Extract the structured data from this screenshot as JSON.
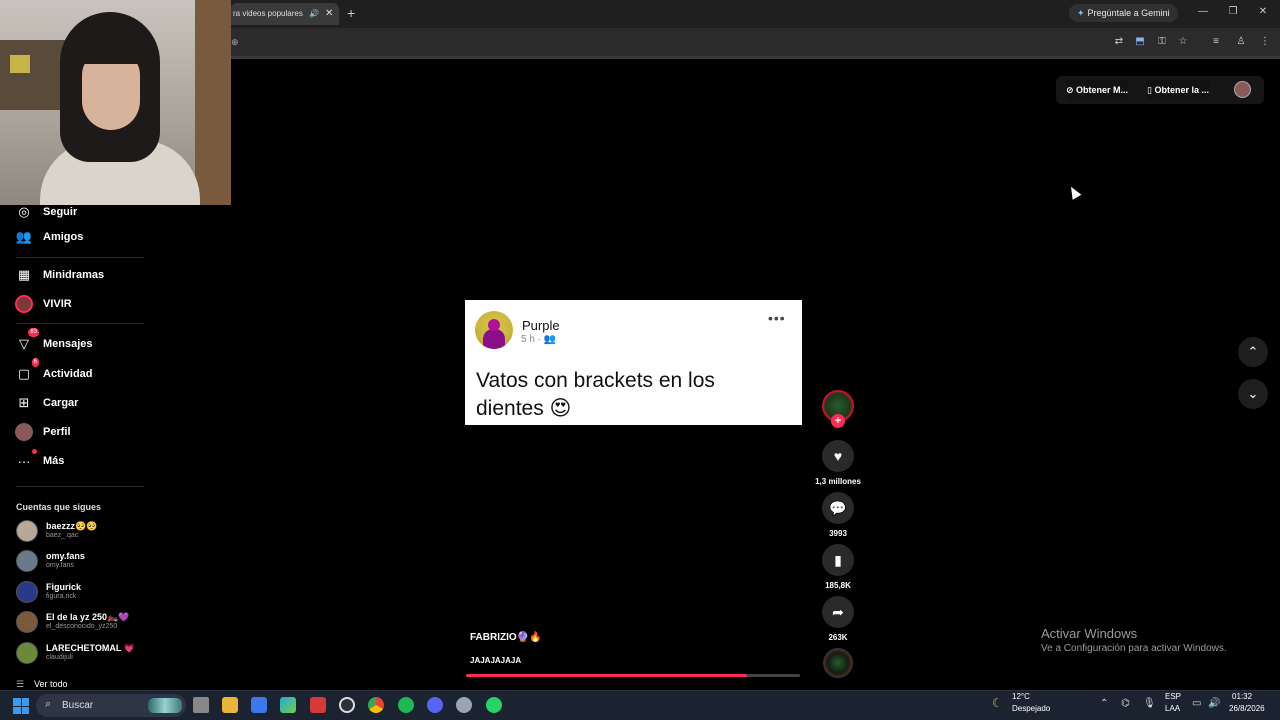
{
  "browser": {
    "tab_title": "ra videos populares",
    "tab_speaker": "🔊",
    "tab_close": "✕",
    "new_tab": "+",
    "gemini_label": "Pregúntale a Gemini",
    "win_minimize": "—",
    "win_restore": "❐",
    "win_close": "✕",
    "addr_fragment": "⊕"
  },
  "sidebar": {
    "items": [
      {
        "label": "Seguir"
      },
      {
        "label": "Amigos"
      },
      {
        "label": "Minidramas"
      },
      {
        "label": "VIVIR"
      },
      {
        "label": "Mensajes",
        "badge": "83"
      },
      {
        "label": "Actividad",
        "badge": "6"
      },
      {
        "label": "Cargar"
      },
      {
        "label": "Perfil"
      },
      {
        "label": "Más"
      }
    ],
    "following_title": "Cuentas que sigues",
    "accounts": [
      {
        "name": "baezzz🥺🥺",
        "handle": "baez_.qac"
      },
      {
        "name": "omy.fans",
        "handle": "omy.fans"
      },
      {
        "name": "Figurick",
        "handle": "figura.rick"
      },
      {
        "name": "El de la yz 250🏍️💜",
        "handle": "el_desconocido_yz250"
      },
      {
        "name": "LARECHETOMAL 💗",
        "handle": "claudijuli"
      }
    ],
    "see_all": "Ver todo"
  },
  "top_actions": {
    "get_m": "Obtener M...",
    "get_app": "Obtener la ..."
  },
  "post": {
    "author": "Purple",
    "meta": "5 h · 👥",
    "more": "•••",
    "text": "Vatos con brackets en los dientes 😍"
  },
  "video": {
    "user": "FABRIZIO🔮🔥",
    "caption": "JAJAJAJAJA",
    "progress": 0.84
  },
  "rail": {
    "follow_plus": "+",
    "likes": "1,3 millones",
    "comments": "3993",
    "saves": "185,8K",
    "shares": "263K"
  },
  "nav": {
    "up": "⌃",
    "down": "⌄"
  },
  "watermark": {
    "title": "Activar Windows",
    "subtitle": "Ve a Configuración para activar Windows."
  },
  "taskbar": {
    "search_label": "Buscar",
    "weather_temp": "12°C",
    "weather_desc": "Despejado",
    "lang1": "ESP",
    "lang2": "LAA",
    "time": "01:32",
    "date": "26/8/2026"
  },
  "colors": {
    "accent": "#fe2c55",
    "taskbar": "#1b2230"
  }
}
